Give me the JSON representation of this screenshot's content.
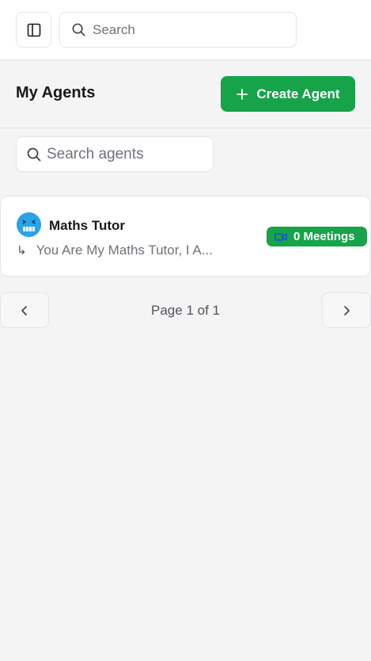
{
  "top_search": {
    "placeholder": "Search"
  },
  "header": {
    "title": "My Agents",
    "create_label": "Create Agent"
  },
  "agent_search": {
    "placeholder": "Search agents"
  },
  "agents": [
    {
      "name": "Maths Tutor",
      "instructions": "You Are My Maths Tutor, I A...",
      "meetings_label": "0 Meetings",
      "avatar_icon": "smiley-face-icon"
    }
  ],
  "pagination": {
    "label": "Page 1 of 1"
  },
  "colors": {
    "accent": "#16a34a",
    "avatar": "#2aa3e8",
    "background": "#f4f4f5"
  }
}
